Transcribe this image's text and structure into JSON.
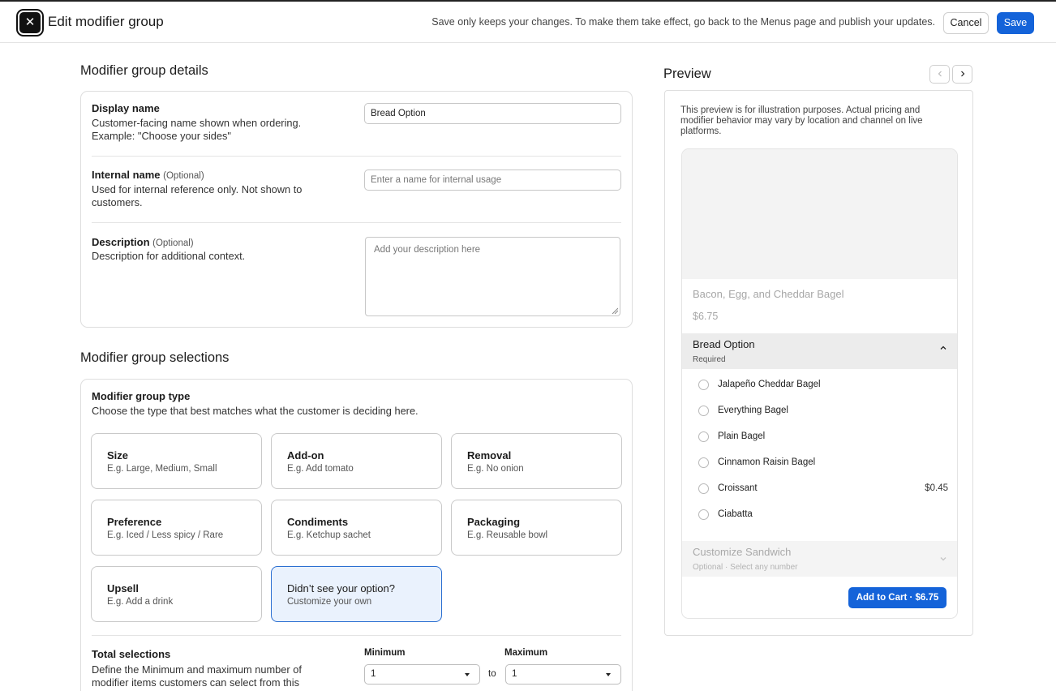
{
  "header": {
    "close_icon": "close-icon",
    "title": "Edit modifier group",
    "save_note": "Save only keeps your changes. To make them take effect, go back to the Menus page and publish your updates.",
    "cancel_label": "Cancel",
    "save_label": "Save",
    "accent_color": "#1463d9"
  },
  "details": {
    "section_title": "Modifier group details",
    "display_name": {
      "label": "Display name",
      "help": "Customer-facing name shown when ordering. Example: \"Choose your sides\"",
      "value": "Bread Option"
    },
    "internal_name": {
      "label": "Internal name",
      "optional": "(Optional)",
      "help": "Used for internal reference only. Not shown to customers.",
      "placeholder": "Enter a name for internal usage"
    },
    "description": {
      "label": "Description",
      "optional": "(Optional)",
      "help": "Description for additional context.",
      "placeholder": "Add your description here"
    }
  },
  "selections": {
    "section_title": "Modifier group selections",
    "type_label": "Modifier group type",
    "type_help": "Choose the type that best matches what the customer is deciding here.",
    "types": [
      {
        "name": "Size",
        "example": "E.g. Large, Medium, Small"
      },
      {
        "name": "Add-on",
        "example": "E.g. Add tomato"
      },
      {
        "name": "Removal",
        "example": "E.g. No onion"
      },
      {
        "name": "Preference",
        "example": "E.g. Iced / Less spicy / Rare"
      },
      {
        "name": "Condiments",
        "example": "E.g. Ketchup sachet"
      },
      {
        "name": "Packaging",
        "example": "E.g. Reusable bowl"
      },
      {
        "name": "Upsell",
        "example": "E.g. Add a drink"
      },
      {
        "name": "Didn’t see your option?",
        "example": "Customize your own",
        "selected": true
      }
    ],
    "total_label": "Total selections",
    "total_help": "Define the Minimum and maximum number of modifier items customers can select from this",
    "minimum_label": "Minimum",
    "maximum_label": "Maximum",
    "minimum_value": "1",
    "maximum_value": "1",
    "to_label": "to"
  },
  "preview": {
    "title": "Preview",
    "prev_icon": "chevron-left-icon",
    "next_icon": "chevron-right-icon",
    "note": "This preview is for illustration purposes. Actual pricing and modifier behavior may vary by location and channel on live platforms.",
    "item_name": "Bacon, Egg, and Cheddar Bagel",
    "item_price": "$6.75",
    "group": {
      "name": "Bread Option",
      "status": "Required",
      "chevron_icon": "chevron-up-icon"
    },
    "options": [
      {
        "name": "Jalapeño Cheddar Bagel",
        "price": ""
      },
      {
        "name": "Everything Bagel",
        "price": ""
      },
      {
        "name": "Plain Bagel",
        "price": ""
      },
      {
        "name": "Cinnamon Raisin Bagel",
        "price": ""
      },
      {
        "name": "Croissant",
        "price": "$0.45"
      },
      {
        "name": "Ciabatta",
        "price": ""
      }
    ],
    "group2": {
      "name": "Customize Sandwich",
      "sub": "Optional · Select any number",
      "chevron_icon": "chevron-down-icon"
    },
    "add_to_cart": "Add to Cart · $6.75"
  }
}
